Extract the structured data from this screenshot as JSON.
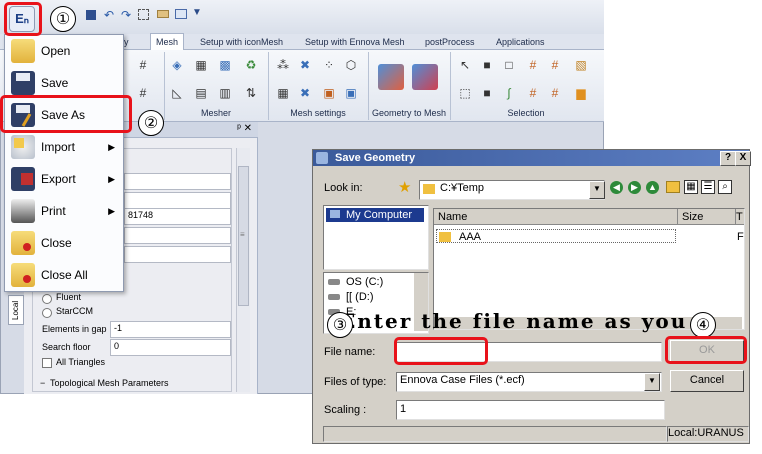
{
  "app": {
    "logo_label": "Eₙ",
    "tabs": [
      "Mesh",
      "Setup with iconMesh",
      "Setup with Ennova Mesh",
      "postProcess",
      "Applications"
    ],
    "partial_tab": "y",
    "groups": [
      "Mesher",
      "Mesh settings",
      "Geometry to Mesh",
      "Selection"
    ],
    "panel_pin": "ᵖ ✕",
    "left_panel": {
      "id_value": "81748",
      "radio_fluent": "Fluent",
      "radio_starccm": "StarCCM",
      "elements_in_gap_label": "Elements in gap",
      "elements_in_gap_value": "-1",
      "search_floor_label": "Search floor",
      "search_floor_value": "0",
      "all_triangles_label": "All Triangles",
      "section_title": "Topological Mesh Parameters",
      "vertical_tab": "Local"
    }
  },
  "menu": {
    "items": [
      {
        "label": "Open",
        "arrow": ""
      },
      {
        "label": "Save",
        "arrow": ""
      },
      {
        "label": "Save As",
        "arrow": ""
      },
      {
        "label": "Import",
        "arrow": "▶"
      },
      {
        "label": "Export",
        "arrow": "▶"
      },
      {
        "label": "Print",
        "arrow": "▶"
      },
      {
        "label": "Close",
        "arrow": ""
      },
      {
        "label": "Close All",
        "arrow": ""
      }
    ]
  },
  "annotations": {
    "n1": "①",
    "n2": "②",
    "n3": "③",
    "n4": "④",
    "instruction": "Enter the file name as you"
  },
  "dialog": {
    "title": "Save Geometry",
    "help_btn": "?",
    "close_btn": "X",
    "look_in_label": "Look in:",
    "look_in_value": "C:¥Temp",
    "places": [
      "My Computer"
    ],
    "drives": [
      "OS (C:)",
      "[[ (D:)",
      "E:"
    ],
    "col_name": "Name",
    "col_size": "Size",
    "col_t": "T",
    "files": [
      {
        "name": "AAA",
        "type": "F"
      }
    ],
    "file_name_label": "File name:",
    "file_name_value": "",
    "ok_label": "OK",
    "files_of_type_label": "Files of type:",
    "files_of_type_value": "Ennova Case Files (*.ecf)",
    "cancel_label": "Cancel",
    "scaling_label": "Scaling :",
    "scaling_value": "1",
    "status_text": "Local:URANUS"
  },
  "colors": {
    "highlight": "#e8121a",
    "title_bar": "#3b5a9a"
  }
}
